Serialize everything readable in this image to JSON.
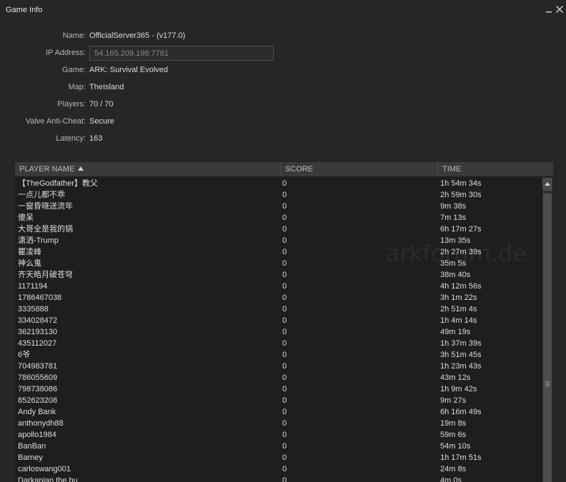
{
  "window": {
    "title": "Game Info"
  },
  "server": {
    "name_label": "Name:",
    "name_value": "OfficialServer365 - (v177.0)",
    "ip_label": "IP Address:",
    "ip_value": "54.165.209.198:7781",
    "game_label": "Game:",
    "game_value": "ARK: Survival Evolved",
    "map_label": "Map:",
    "map_value": "TheIsland",
    "players_label": "Players:",
    "players_value": "70 / 70",
    "vac_label": "Valve Anti-Cheat:",
    "vac_value": "Secure",
    "latency_label": "Latency:",
    "latency_value": "163"
  },
  "table": {
    "columns": [
      "PLAYER NAME",
      "SCORE",
      "TIME"
    ],
    "sort_column": "PLAYER NAME",
    "sort_direction": "ascending",
    "rows": [
      {
        "name": "【TheGodfather】教父",
        "score": "0",
        "time": "1h 54m 34s"
      },
      {
        "name": "一点儿都不乖",
        "score": "0",
        "time": "2h 59m 30s"
      },
      {
        "name": "一窗昏晓送流年",
        "score": "0",
        "time": "9m 38s"
      },
      {
        "name": "傻呆",
        "score": "0",
        "time": "7m 13s"
      },
      {
        "name": "大哥全是我的锅",
        "score": "0",
        "time": "6h 17m 27s"
      },
      {
        "name": "潇洒-Trump",
        "score": "0",
        "time": "13m 35s"
      },
      {
        "name": "瞿凌峰",
        "score": "0",
        "time": "2h 27m 39s"
      },
      {
        "name": "神么鬼",
        "score": "0",
        "time": "35m 5s"
      },
      {
        "name": "齐天皓月破苍穹",
        "score": "0",
        "time": "38m 40s"
      },
      {
        "name": "1171194",
        "score": "0",
        "time": "4h 12m 56s"
      },
      {
        "name": "1786467038",
        "score": "0",
        "time": "3h 1m 22s"
      },
      {
        "name": "3335888",
        "score": "0",
        "time": "2h 51m 4s"
      },
      {
        "name": "334028472",
        "score": "0",
        "time": "1h 4m 14s"
      },
      {
        "name": "362193130",
        "score": "0",
        "time": "49m 19s"
      },
      {
        "name": "435112027",
        "score": "0",
        "time": "1h 37m 39s"
      },
      {
        "name": "6爷",
        "score": "0",
        "time": "3h 51m 45s"
      },
      {
        "name": "704983781",
        "score": "0",
        "time": "1h 23m 43s"
      },
      {
        "name": "786055609",
        "score": "0",
        "time": "43m 12s"
      },
      {
        "name": "798738086",
        "score": "0",
        "time": "1h 9m 42s"
      },
      {
        "name": "852623208",
        "score": "0",
        "time": "9m 27s"
      },
      {
        "name": "Andy Bank",
        "score": "0",
        "time": "6h 16m 49s"
      },
      {
        "name": "anthonydh88",
        "score": "0",
        "time": "19m 8s"
      },
      {
        "name": "apollo1984",
        "score": "0",
        "time": "59m 6s"
      },
      {
        "name": "BanBan",
        "score": "0",
        "time": "54m 10s"
      },
      {
        "name": "Barney",
        "score": "0",
        "time": "1h 17m 51s"
      },
      {
        "name": "carloswang001",
        "score": "0",
        "time": "24m 8s"
      },
      {
        "name": "Darkanian the bu",
        "score": "0",
        "time": "4m 0s"
      }
    ]
  },
  "watermark": "arkforum.de",
  "icons": {
    "minimize": "minimize-icon",
    "close": "close-icon",
    "sort": "sort-ascending-icon",
    "scroll_up": "scroll-up-arrow-icon",
    "grip": "scroll-grip-icon"
  },
  "colors": {
    "background": "#262626",
    "table_background": "#1e1e1e",
    "header_background": "#3a3a3a",
    "text": "#dcdcdc",
    "muted_text": "#b8b8b8"
  }
}
